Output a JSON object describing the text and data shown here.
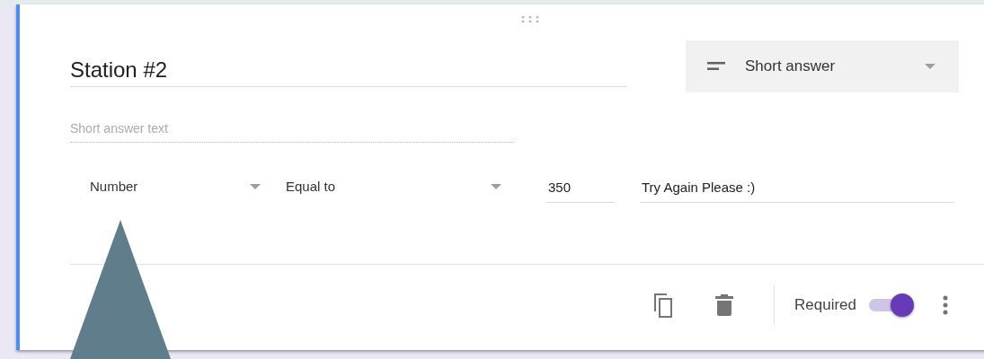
{
  "question": {
    "title": "Station #2",
    "type_label": "Short answer",
    "answer_placeholder": "Short answer text"
  },
  "validation": {
    "type": "Number",
    "condition": "Equal to",
    "value": "350",
    "error_text": "Try Again Please :)"
  },
  "footer": {
    "required_label": "Required",
    "required_on": true
  }
}
